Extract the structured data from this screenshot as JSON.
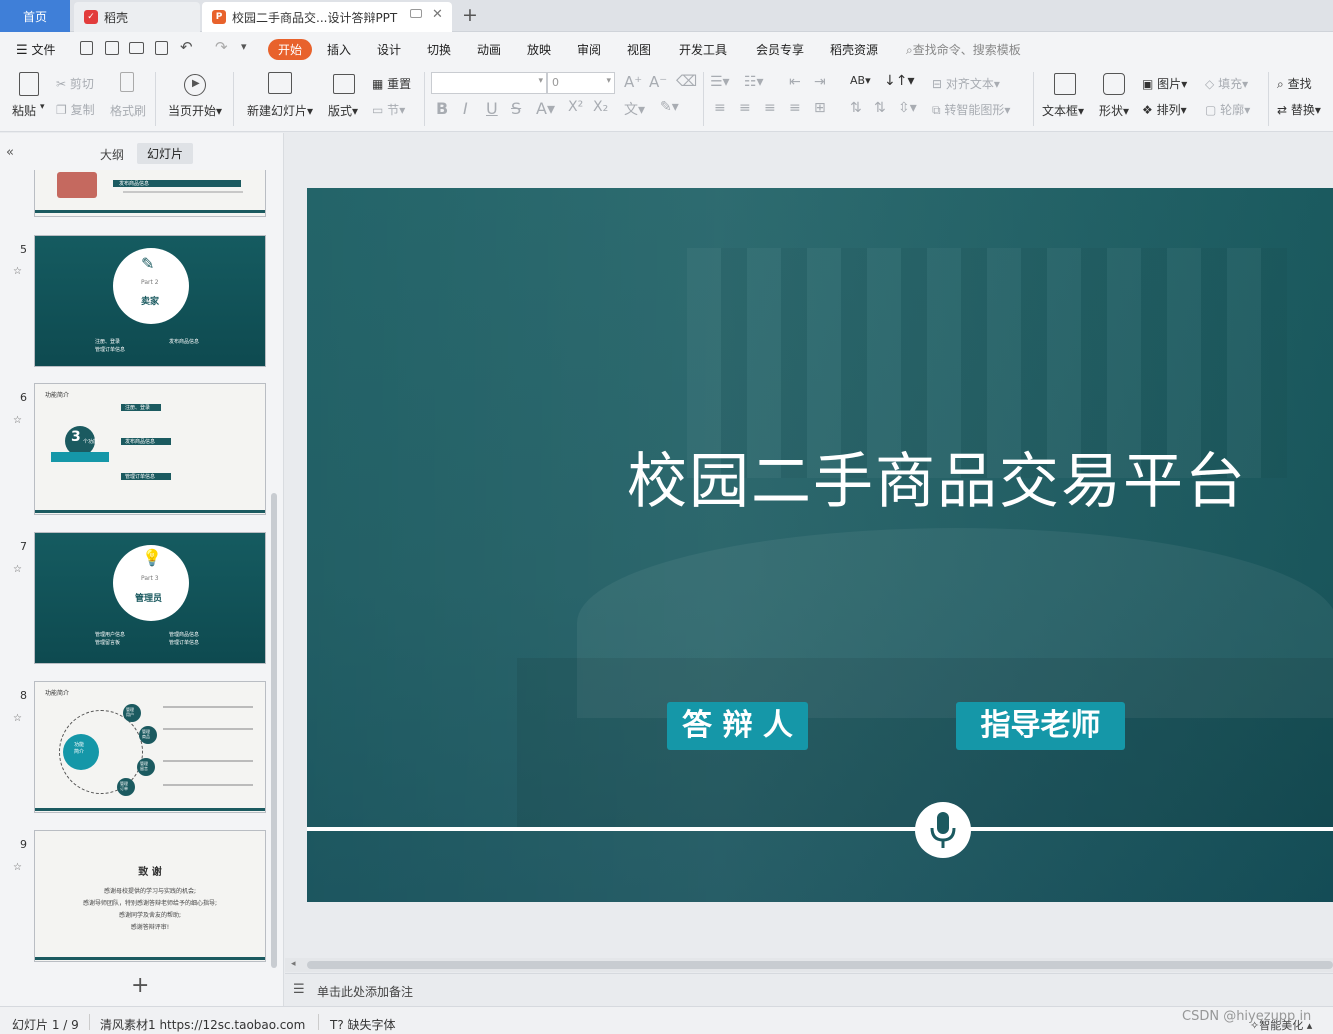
{
  "tabs": {
    "home": "首页",
    "daoke": "稻壳",
    "doc": "校园二手商品交...设计答辩PPT"
  },
  "menu": {
    "file": "文件",
    "items": [
      "开始",
      "插入",
      "设计",
      "切换",
      "动画",
      "放映",
      "审阅",
      "视图",
      "开发工具",
      "会员专享",
      "稻壳资源"
    ],
    "search": "查找命令、搜索模板"
  },
  "ribbon": {
    "paste": "粘贴",
    "cut": "剪切",
    "copy": "复制",
    "format_painter": "格式刷",
    "from_current": "当页开始",
    "new_slide": "新建幻灯片",
    "layout": "版式",
    "section": "节",
    "reset": "重置",
    "font_size": "0",
    "align_text": "对齐文本",
    "smart_shape": "转智能图形",
    "textbox": "文本框",
    "shape": "形状",
    "arrange": "排列",
    "picture": "图片",
    "fill": "填充",
    "outline": "轮廓",
    "find": "查找",
    "replace": "替换"
  },
  "panel": {
    "outline_tab": "大纲",
    "slides_tab": "幻灯片"
  },
  "thumbs": {
    "t4": {
      "text": "发布商品信息"
    },
    "t5": {
      "num": "5",
      "part": "Part 2",
      "title": "卖家",
      "b1": "注册、登录",
      "b2": "管理订单信息",
      "b3": "发布商品信息"
    },
    "t6": {
      "num": "6",
      "heading": "功能简介",
      "circle": "3",
      "circle_sub": "个功能",
      "l1": "注册、登录",
      "l2": "发布商品信息",
      "l3": "管理订单信息"
    },
    "t7": {
      "num": "7",
      "part": "Part 3",
      "title": "管理员",
      "b1": "管理用户信息",
      "b2": "管理留言板",
      "b3": "管理商品信息",
      "b4": "管理订单信息"
    },
    "t8": {
      "num": "8",
      "heading": "功能简介",
      "center": "功能\n简介",
      "n1": "管理\n用户",
      "n2": "管理\n商品",
      "n3": "管理\n留言",
      "n4": "管理\n订单"
    },
    "t9": {
      "num": "9",
      "title": "致 谢",
      "l1": "感谢母校提供的学习与实践的机会;",
      "l2": "感谢导师团队，特别感谢答辩老师给予的细心指导;",
      "l3": "感谢同学及舍友的帮助;",
      "l4": "感谢答辩评审!"
    }
  },
  "slide": {
    "title": "校园二手商品交易平台",
    "tag1": "答 辩 人",
    "tag2": "指导老师"
  },
  "notes": "单击此处添加备注",
  "status": {
    "slide": "幻灯片 1 / 9",
    "theme": "清风素材1 https://12sc.taobao.com",
    "missing_font": "缺失字体",
    "smart": "智能美化",
    "watermark": "CSDN @hiyezupp in"
  },
  "colors": {
    "accent": "#e8622c",
    "teal": "#1b5a60",
    "tag": "#1597a8"
  }
}
